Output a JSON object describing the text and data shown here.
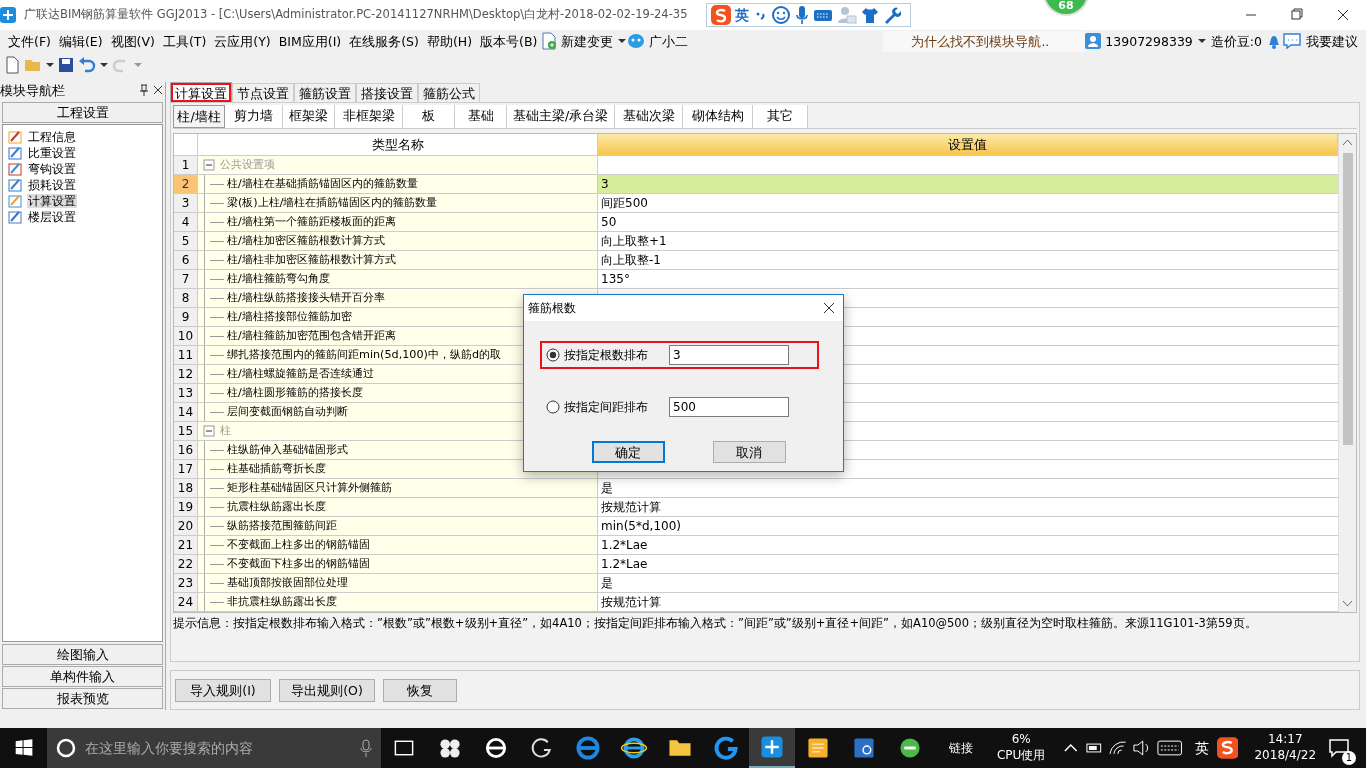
{
  "window": {
    "title": "广联达BIM钢筋算量软件 GGJ2013 - [C:\\Users\\Administrator.PC-20141127NRHM\\Desktop\\白龙村-2018-02-02-19-24-35"
  },
  "ime_bar": {
    "mode": "英"
  },
  "floating_badge": {
    "count": "68"
  },
  "menu": [
    "文件(F)",
    "编辑(E)",
    "视图(V)",
    "工具(T)",
    "云应用(Y)",
    "BIM应用(I)",
    "在线服务(S)",
    "帮助(H)",
    "版本号(B)"
  ],
  "menu_extras": [
    {
      "label": "新建变更",
      "kind": "dropdown"
    },
    {
      "label": "广小二",
      "kind": "plain"
    }
  ],
  "help_banner": "为什么找不到模块导航..",
  "account": {
    "user": "13907298339",
    "beans": "造价豆:0",
    "feedback": "我要建议"
  },
  "nav": {
    "title": "模块导航栏",
    "section": "工程设置",
    "items": [
      {
        "label": "工程信息",
        "selected": false
      },
      {
        "label": "比重设置",
        "selected": false
      },
      {
        "label": "弯钩设置",
        "selected": false
      },
      {
        "label": "损耗设置",
        "selected": false
      },
      {
        "label": "计算设置",
        "selected": true
      },
      {
        "label": "楼层设置",
        "selected": false
      }
    ],
    "bottom": [
      "绘图输入",
      "单构件输入",
      "报表预览"
    ]
  },
  "tabs": [
    {
      "label": "计算设置",
      "selected": true,
      "highlighted": true
    },
    {
      "label": "节点设置",
      "selected": false,
      "highlighted": false
    },
    {
      "label": "箍筋设置",
      "selected": false,
      "highlighted": false
    },
    {
      "label": "搭接设置",
      "selected": false,
      "highlighted": false
    },
    {
      "label": "箍筋公式",
      "selected": false,
      "highlighted": false
    }
  ],
  "subtabs": [
    {
      "label": "柱/墙柱",
      "selected": true
    },
    {
      "label": "剪力墙",
      "selected": false
    },
    {
      "label": "框架梁",
      "selected": false
    },
    {
      "label": "非框架梁",
      "selected": false
    },
    {
      "label": "板",
      "selected": false
    },
    {
      "label": "基础",
      "selected": false
    },
    {
      "label": "基础主梁/承台梁",
      "selected": false
    },
    {
      "label": "基础次梁",
      "selected": false
    },
    {
      "label": "砌体结构",
      "selected": false
    },
    {
      "label": "其它",
      "selected": false
    }
  ],
  "table": {
    "columns": [
      "类型名称",
      "设置值"
    ],
    "rows": [
      {
        "no": "1",
        "kind": "group",
        "name": "公共设置项",
        "expanded": true,
        "selected": false,
        "highlighted": false
      },
      {
        "no": "2",
        "kind": "item",
        "name": "柱/墙柱在基础插筋锚固区内的箍筋数量",
        "value": "3",
        "selected": true,
        "highlighted": true
      },
      {
        "no": "3",
        "kind": "item",
        "name": "梁(板)上柱/墙柱在插筋锚固区内的箍筋数量",
        "value": "间距500",
        "selected": false,
        "highlighted": false
      },
      {
        "no": "4",
        "kind": "item",
        "name": "柱/墙柱第一个箍筋距楼板面的距离",
        "value": "50",
        "selected": false,
        "highlighted": false
      },
      {
        "no": "5",
        "kind": "item",
        "name": "柱/墙柱加密区箍筋根数计算方式",
        "value": "向上取整+1",
        "selected": false,
        "highlighted": false
      },
      {
        "no": "6",
        "kind": "item",
        "name": "柱/墙柱非加密区箍筋根数计算方式",
        "value": "向上取整-1",
        "selected": false,
        "highlighted": false
      },
      {
        "no": "7",
        "kind": "item",
        "name": "柱/墙柱箍筋弯勾角度",
        "value": "135°",
        "selected": false,
        "highlighted": false
      },
      {
        "no": "8",
        "kind": "item",
        "name": "柱/墙柱纵筋搭接接头错开百分率",
        "selected": false,
        "highlighted": false
      },
      {
        "no": "9",
        "kind": "item",
        "name": "柱/墙柱搭接部位箍筋加密",
        "selected": false,
        "highlighted": false
      },
      {
        "no": "10",
        "kind": "item",
        "name": "柱/墙柱箍筋加密范围包含错开距离",
        "selected": false,
        "highlighted": false
      },
      {
        "no": "11",
        "kind": "item",
        "name": "绑扎搭接范围内的箍筋间距min(5d,100)中，纵筋d的取",
        "selected": false,
        "highlighted": false
      },
      {
        "no": "12",
        "kind": "item",
        "name": "柱/墙柱螺旋箍筋是否连续通过",
        "selected": false,
        "highlighted": false
      },
      {
        "no": "13",
        "kind": "item",
        "name": "柱/墙柱圆形箍筋的搭接长度",
        "selected": false,
        "highlighted": false
      },
      {
        "no": "14",
        "kind": "item",
        "name": "层间变截面钢筋自动判断",
        "selected": false,
        "highlighted": false
      },
      {
        "no": "15",
        "kind": "group",
        "name": "柱",
        "expanded": true,
        "selected": false,
        "highlighted": false
      },
      {
        "no": "16",
        "kind": "item",
        "name": "柱纵筋伸入基础锚固形式",
        "selected": false,
        "highlighted": false
      },
      {
        "no": "17",
        "kind": "item",
        "name": "柱基础插筋弯折长度",
        "selected": false,
        "highlighted": false
      },
      {
        "no": "18",
        "kind": "item",
        "name": "矩形柱基础锚固区只计算外侧箍筋",
        "value": "是",
        "selected": false,
        "highlighted": false
      },
      {
        "no": "19",
        "kind": "item",
        "name": "抗震柱纵筋露出长度",
        "value": "按规范计算",
        "selected": false,
        "highlighted": false
      },
      {
        "no": "20",
        "kind": "item",
        "name": "纵筋搭接范围箍筋间距",
        "value": "min(5*d,100)",
        "selected": false,
        "highlighted": false
      },
      {
        "no": "21",
        "kind": "item",
        "name": "不变截面上柱多出的钢筋锚固",
        "value": "1.2*Lae",
        "selected": false,
        "highlighted": false
      },
      {
        "no": "22",
        "kind": "item",
        "name": "不变截面下柱多出的钢筋锚固",
        "value": "1.2*Lae",
        "selected": false,
        "highlighted": false
      },
      {
        "no": "23",
        "kind": "item",
        "name": "基础顶部按嵌固部位处理",
        "value": "是",
        "selected": false,
        "highlighted": false
      },
      {
        "no": "24",
        "kind": "item",
        "name": "非抗震柱纵筋露出长度",
        "value": "按规范计算",
        "selected": false,
        "highlighted": false
      }
    ]
  },
  "hint": "提示信息：按指定根数排布输入格式：”根数”或”根数+级别+直径”，如4A10；按指定间距排布输入格式：”间距”或”级别+直径+间距”，如A10@500；级别直径为空时取柱箍筋。来源11G101-3第59页。",
  "buttons": [
    "导入规则(I)",
    "导出规则(O)",
    "恢复"
  ],
  "dialog": {
    "title": "箍筋根数",
    "options": [
      {
        "label": "按指定根数排布",
        "value": "3",
        "selected": true,
        "highlighted": true
      },
      {
        "label": "按指定间距排布",
        "value": "500",
        "selected": false,
        "highlighted": false
      }
    ],
    "buttons": [
      {
        "label": "确定",
        "kind": "default"
      },
      {
        "label": "取消",
        "kind": "normal"
      }
    ]
  },
  "taskbar": {
    "search_placeholder": "在这里输入你要搜索的内容",
    "toolbar_label": "链接",
    "cpu_percent": "6%",
    "cpu_label": "CPU使用",
    "ime": "英",
    "time": "14:17",
    "date": "2018/4/22",
    "notifications": "1"
  }
}
